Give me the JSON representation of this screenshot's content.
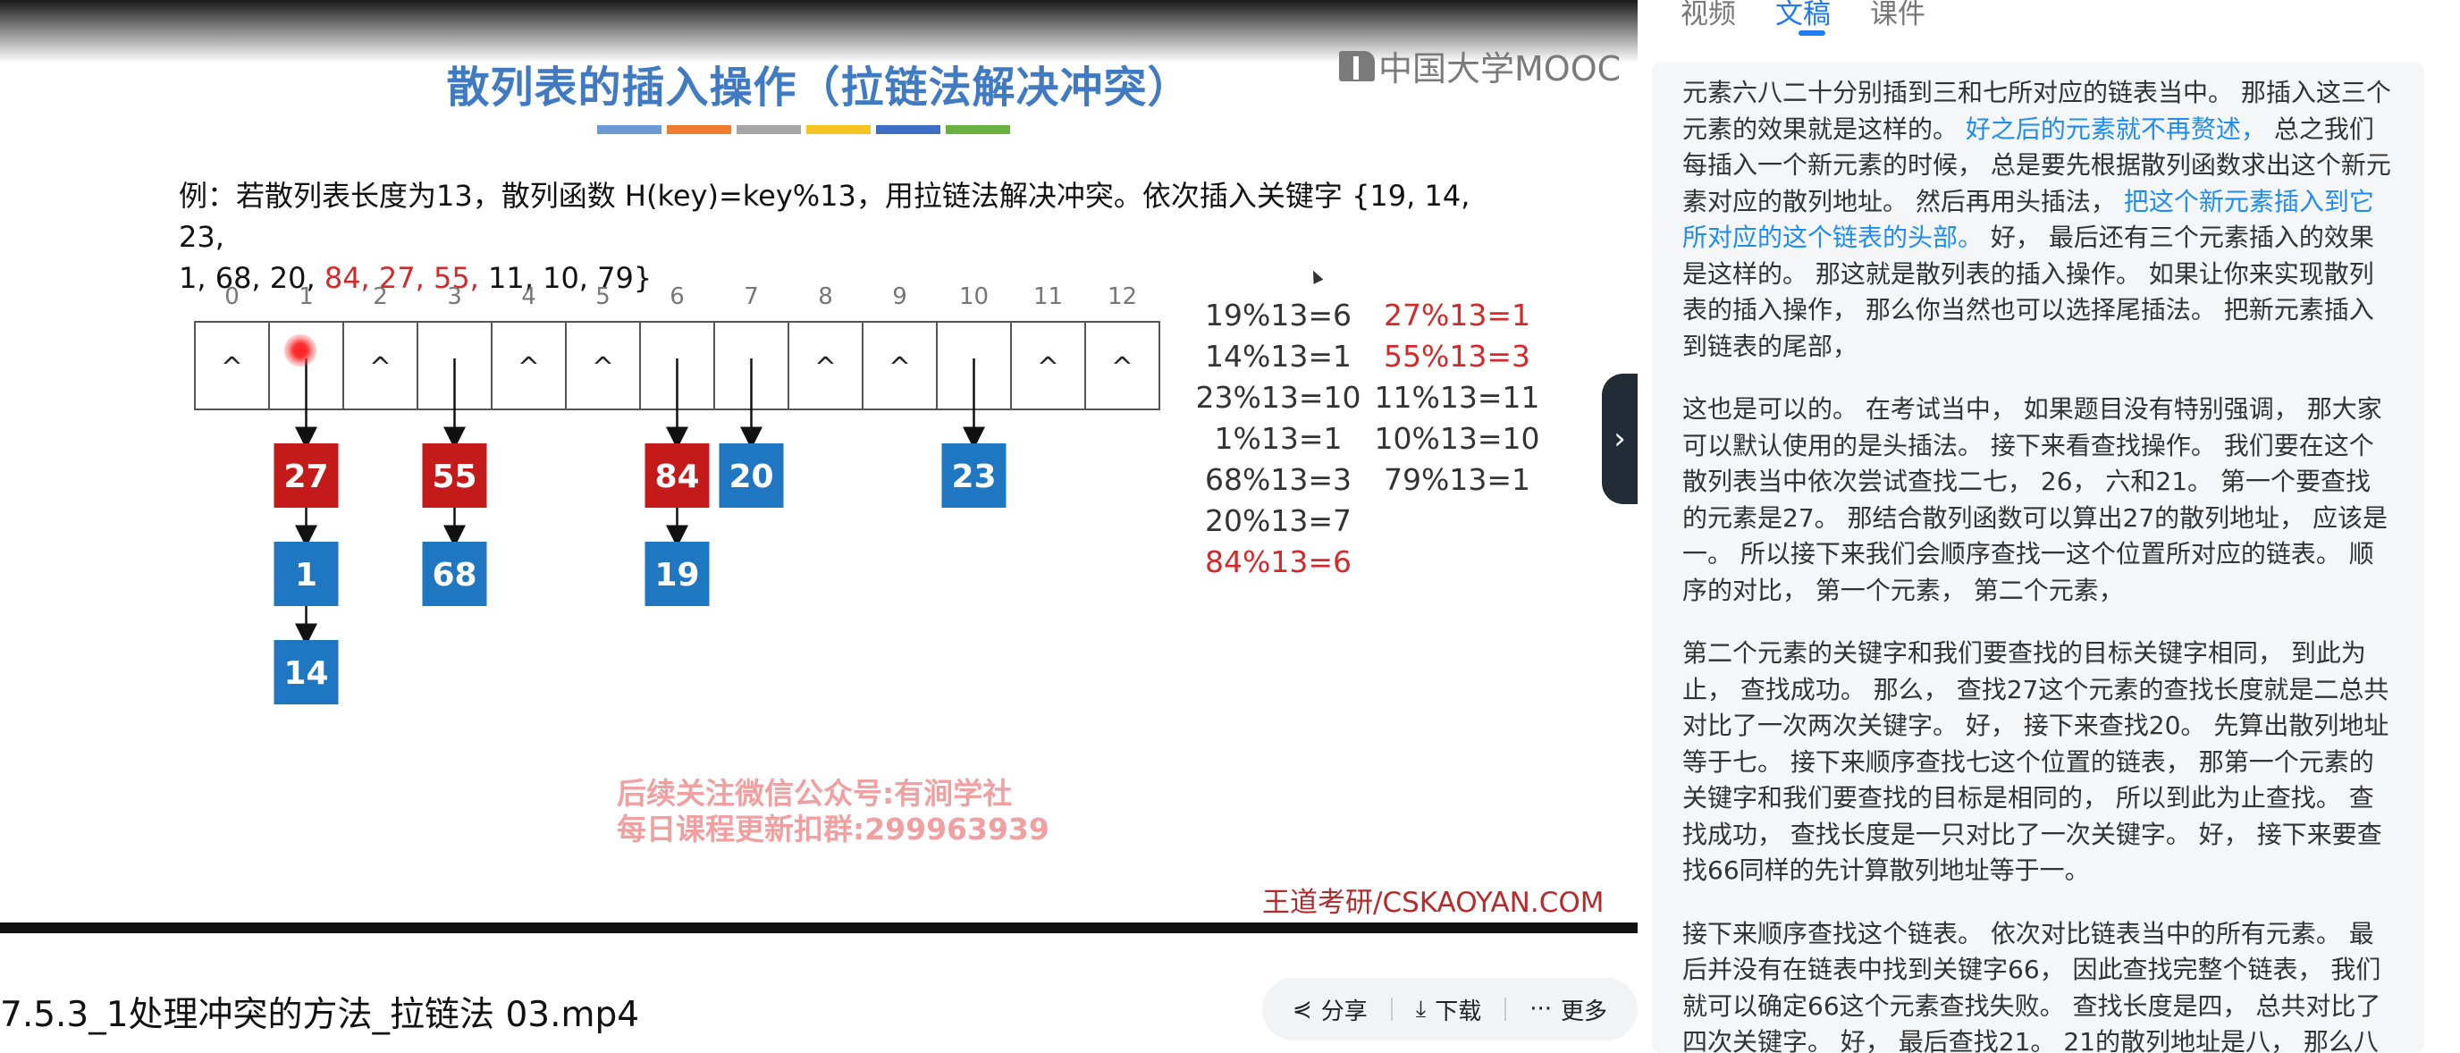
{
  "slide": {
    "title": "散列表的插入操作（拉链法解决冲突）",
    "title_bar_colors": [
      "#6b9ad6",
      "#ef7c2f",
      "#a6a6a6",
      "#f5c422",
      "#3f6fc4",
      "#6bb13f"
    ],
    "logo_text": "中国大学MOOC",
    "problem_part1": "例：若散列表长度为13，散列函数 H(key)=key%13，用拉链法解决冲突。依次插入关键字 {19, 14, 23,",
    "problem_part2": "1, 68, 20, ",
    "problem_red": "84, 27, 55,",
    "problem_part3": " 11, 10, 79}",
    "indices": [
      "0",
      "1",
      "2",
      "3",
      "4",
      "5",
      "6",
      "7",
      "8",
      "9",
      "10",
      "11",
      "12"
    ],
    "empty_marker": "^",
    "chains": [
      {
        "index": 1,
        "nodes": [
          {
            "key": "27",
            "color": "#c41a1a"
          },
          {
            "key": "1",
            "color": "#1f77c2"
          },
          {
            "key": "14",
            "color": "#1f77c2"
          }
        ]
      },
      {
        "index": 3,
        "nodes": [
          {
            "key": "55",
            "color": "#c41a1a"
          },
          {
            "key": "68",
            "color": "#1f77c2"
          }
        ]
      },
      {
        "index": 6,
        "nodes": [
          {
            "key": "84",
            "color": "#c41a1a"
          },
          {
            "key": "19",
            "color": "#1f77c2"
          }
        ]
      },
      {
        "index": 7,
        "nodes": [
          {
            "key": "20",
            "color": "#1f77c2"
          }
        ]
      },
      {
        "index": 10,
        "nodes": [
          {
            "key": "23",
            "color": "#1f77c2"
          }
        ]
      }
    ],
    "calc_left": [
      {
        "text": "19%13=6",
        "red": false
      },
      {
        "text": "14%13=1",
        "red": false
      },
      {
        "text": "23%13=10",
        "red": false
      },
      {
        "text": "1%13=1",
        "red": false
      },
      {
        "text": "68%13=3",
        "red": false
      },
      {
        "text": "20%13=7",
        "red": false
      },
      {
        "text": "84%13=6",
        "red": true
      }
    ],
    "calc_right": [
      {
        "text": "27%13=1",
        "red": true
      },
      {
        "text": "55%13=3",
        "red": true
      },
      {
        "text": "11%13=11",
        "red": false
      },
      {
        "text": "10%13=10",
        "red": false
      },
      {
        "text": "79%13=1",
        "red": false
      }
    ],
    "watermark_line1": "后续关注微信公众号:有涧学社",
    "watermark_line2": "每日课程更新扣群:299963939",
    "site": "王道考研/CSKAOYAN.COM"
  },
  "video": {
    "title": "7.5.3_1处理冲突的方法_拉链法 03.mp4",
    "actions": [
      {
        "icon": "share-icon",
        "glyph": "⋞",
        "label": "分享"
      },
      {
        "icon": "download-icon",
        "glyph": "⤓",
        "label": "下载"
      },
      {
        "icon": "more-icon",
        "glyph": "···",
        "label": "更多"
      }
    ]
  },
  "panel": {
    "tabs": [
      {
        "label": "视频",
        "active": false
      },
      {
        "label": "文稿",
        "active": true
      },
      {
        "label": "课件",
        "active": false
      }
    ],
    "paragraphs": [
      [
        {
          "t": "元素六八二十分别插到三和七所对应的链表当中。 那插入这三个元素的效果就是这样的。 ",
          "hl": false
        },
        {
          "t": "好之后的元素就不再赘述，",
          "hl": true
        },
        {
          "t": " 总之我们每插入一个新元素的时候， 总是要先根据散列函数求出这个新元素对应的散列地址。 然后再用头插法， ",
          "hl": false
        },
        {
          "t": "把这个新元素插入到它所对应的这个链表的头部。",
          "hl": true
        },
        {
          "t": " 好， 最后还有三个元素插入的效果是这样的。 那这就是散列表的插入操作。 如果让你来实现散列表的插入操作， 那么你当然也可以选择尾插法。 把新元素插入到链表的尾部，",
          "hl": false
        }
      ],
      [
        {
          "t": "这也是可以的。 在考试当中， 如果题目没有特别强调， 那大家可以默认使用的是头插法。 接下来看查找操作。 我们要在这个散列表当中依次尝试查找二七， 26， 六和21。 第一个要查找的元素是27。 那结合散列函数可以算出27的散列地址， 应该是一。 所以接下来我们会顺序查找一这个位置所对应的链表。 顺序的对比， 第一个元素， 第二个元素，",
          "hl": false
        }
      ],
      [
        {
          "t": "第二个元素的关键字和我们要查找的目标关键字相同， 到此为止， 查找成功。 那么， 查找27这个元素的查找长度就是二总共对比了一次两次关键字。 好， 接下来查找20。 先算出散列地址等于七。 接下来顺序查找七这个位置的链表， 那第一个元素的关键字和我们要查找的目标是相同的， 所以到此为止查找。 查找成功， 查找长度是一只对比了一次关键字。 好， 接下来要查找66同样的先计算散列地址等于一。",
          "hl": false
        }
      ],
      [
        {
          "t": "接下来顺序查找这个链表。 依次对比链表当中的所有元素。 最后并没有在链表中找到关键字66， 因此查找完整个链表， 我们就可以确定66这个元素查找失败。 查找长度是四， 总共对比了四次关键字。 好， 最后查找21。 21的散列地址是八， 那么八",
          "hl": false
        }
      ]
    ],
    "collapse_glyph": "›"
  }
}
